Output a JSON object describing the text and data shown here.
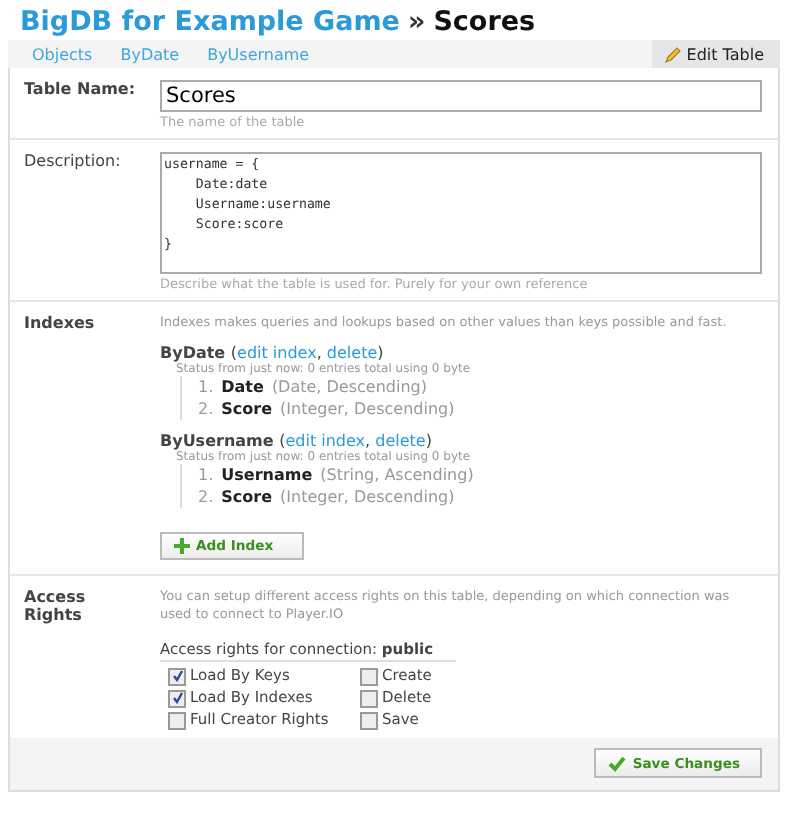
{
  "header": {
    "breadcrumb": "BigDB for Example Game",
    "separator": "»",
    "title": "Scores"
  },
  "tabs": [
    {
      "label": "Objects",
      "selected": false
    },
    {
      "label": "ByDate",
      "selected": false
    },
    {
      "label": "ByUsername",
      "selected": false
    }
  ],
  "edit_button": {
    "label": "Edit Table"
  },
  "table_name": {
    "label": "Table Name:",
    "value": "Scores",
    "hint": "The name of the table"
  },
  "description": {
    "label": "Description:",
    "value": "username = {\n    Date:date\n    Username:username\n    Score:score\n}",
    "hint": "Describe what the table is used for. Purely for your own reference"
  },
  "indexes": {
    "label": "Indexes",
    "intro": "Indexes makes queries and lookups based on other values than keys possible and fast.",
    "items": [
      {
        "name": "ByDate",
        "open": "(",
        "separator": ",",
        "close": ")",
        "edit_link": "edit index",
        "delete_link": "delete",
        "status": "Status from just now: 0 entries total using 0 byte",
        "fields": [
          {
            "number": "1.",
            "name": "Date",
            "detail": "(Date, Descending)"
          },
          {
            "number": "2.",
            "name": "Score",
            "detail": "(Integer, Descending)"
          }
        ]
      },
      {
        "name": "ByUsername",
        "open": "(",
        "separator": ",",
        "close": ")",
        "edit_link": "edit index",
        "delete_link": "delete",
        "status": "Status from just now: 0 entries total using 0 byte",
        "fields": [
          {
            "number": "1.",
            "name": "Username",
            "detail": "(String, Ascending)"
          },
          {
            "number": "2.",
            "name": "Score",
            "detail": "(Integer, Descending)"
          }
        ]
      }
    ],
    "add_button": "Add Index"
  },
  "access_rights": {
    "label": "Access Rights",
    "intro": "You can setup different access rights on this table, depending on which connection was used to connect to Player.IO",
    "connection_label": "Access rights for connection: **public**",
    "options": [
      {
        "label": "Load By Keys",
        "checked": true
      },
      {
        "label": "Create",
        "checked": false
      },
      {
        "label": "Load By Indexes",
        "checked": true
      },
      {
        "label": "Delete",
        "checked": false
      },
      {
        "label": "Full Creator Rights",
        "checked": false
      },
      {
        "label": "Save",
        "checked": false
      }
    ]
  },
  "save_button": "Save Changes"
}
